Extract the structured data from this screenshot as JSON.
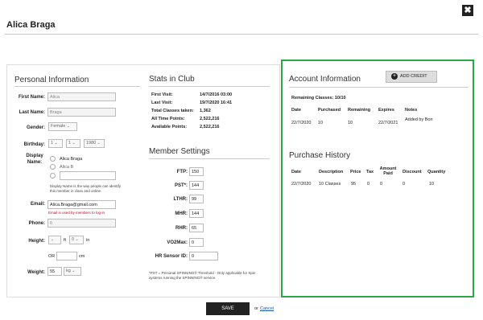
{
  "header": {
    "title": "Alica Braga",
    "close_glyph": "✖"
  },
  "personal": {
    "title": "Personal Information",
    "first_name_label": "First Name:",
    "first_name": "Alica",
    "last_name_label": "Last Name:",
    "last_name": "Braga",
    "gender_label": "Gender:",
    "gender": "Female",
    "birthday_label": "Birthday:",
    "birth_day": "1",
    "birth_month": "1",
    "birth_year": "1980",
    "display_name_label": "Display Name:",
    "display_opt1": "Alica Braga",
    "display_opt2": "Alica B",
    "display_help": "Display Name is the way people can identify this member in class and online.",
    "email_label": "Email:",
    "email": "Alica.Braga@gmail.com",
    "email_note": "Email is used by members to log-in",
    "phone_label": "Phone:",
    "phone_placeholder": "0",
    "height_label": "Height:",
    "height_ft_unit": "ft",
    "height_in_value": "0",
    "height_in_unit": "in",
    "height_or": "OR",
    "height_cm_unit": "cm",
    "weight_label": "Weight:",
    "weight": "55",
    "weight_unit": "kg"
  },
  "stats": {
    "title": "Stats in Club",
    "rows": [
      {
        "label": "First Visit:",
        "value": "14/7/2016 03:00"
      },
      {
        "label": "Last Visit:",
        "value": "19/7/2020 16:41"
      },
      {
        "label": "Total Classes taken:",
        "value": "1,362"
      },
      {
        "label": "All Time Points:",
        "value": "2,522,216"
      },
      {
        "label": "Available Points:",
        "value": "2,522,216"
      }
    ]
  },
  "member": {
    "title": "Member Settings",
    "rows": [
      {
        "label": "FTP:",
        "value": "150"
      },
      {
        "label": "PST*:",
        "value": "144"
      },
      {
        "label": "LTHR:",
        "value": "99"
      },
      {
        "label": "MHR:",
        "value": "144"
      },
      {
        "label": "RHR:",
        "value": "65"
      },
      {
        "label": "VO2Max:",
        "value": "0"
      },
      {
        "label": "HR Sensor ID:",
        "value": "0"
      }
    ],
    "footnote": "*PST = Personal SPINNING® Threshold - Only applicable for Spin systems running the SPINNING® service."
  },
  "account": {
    "title": "Account Information",
    "add_credit": "ADD CREDIT",
    "remaining": "Remaining Classes: 10/10",
    "headers": [
      "Date",
      "Purchased",
      "Remaining",
      "Expires",
      "Notes"
    ],
    "row": [
      "22/7/2020",
      "10",
      "10",
      "22/7/2021",
      "Added by Bon"
    ]
  },
  "purchase": {
    "title": "Purchase History",
    "headers": [
      "Date",
      "Description",
      "Price",
      "Tax",
      "Amount Paid",
      "Discount",
      "Quantity"
    ],
    "row": [
      "22/7/2020",
      "10 Classes",
      "95",
      "0",
      "0",
      "0",
      "10"
    ]
  },
  "footer": {
    "save": "SAVE",
    "or": "or",
    "cancel": "Cancel"
  }
}
